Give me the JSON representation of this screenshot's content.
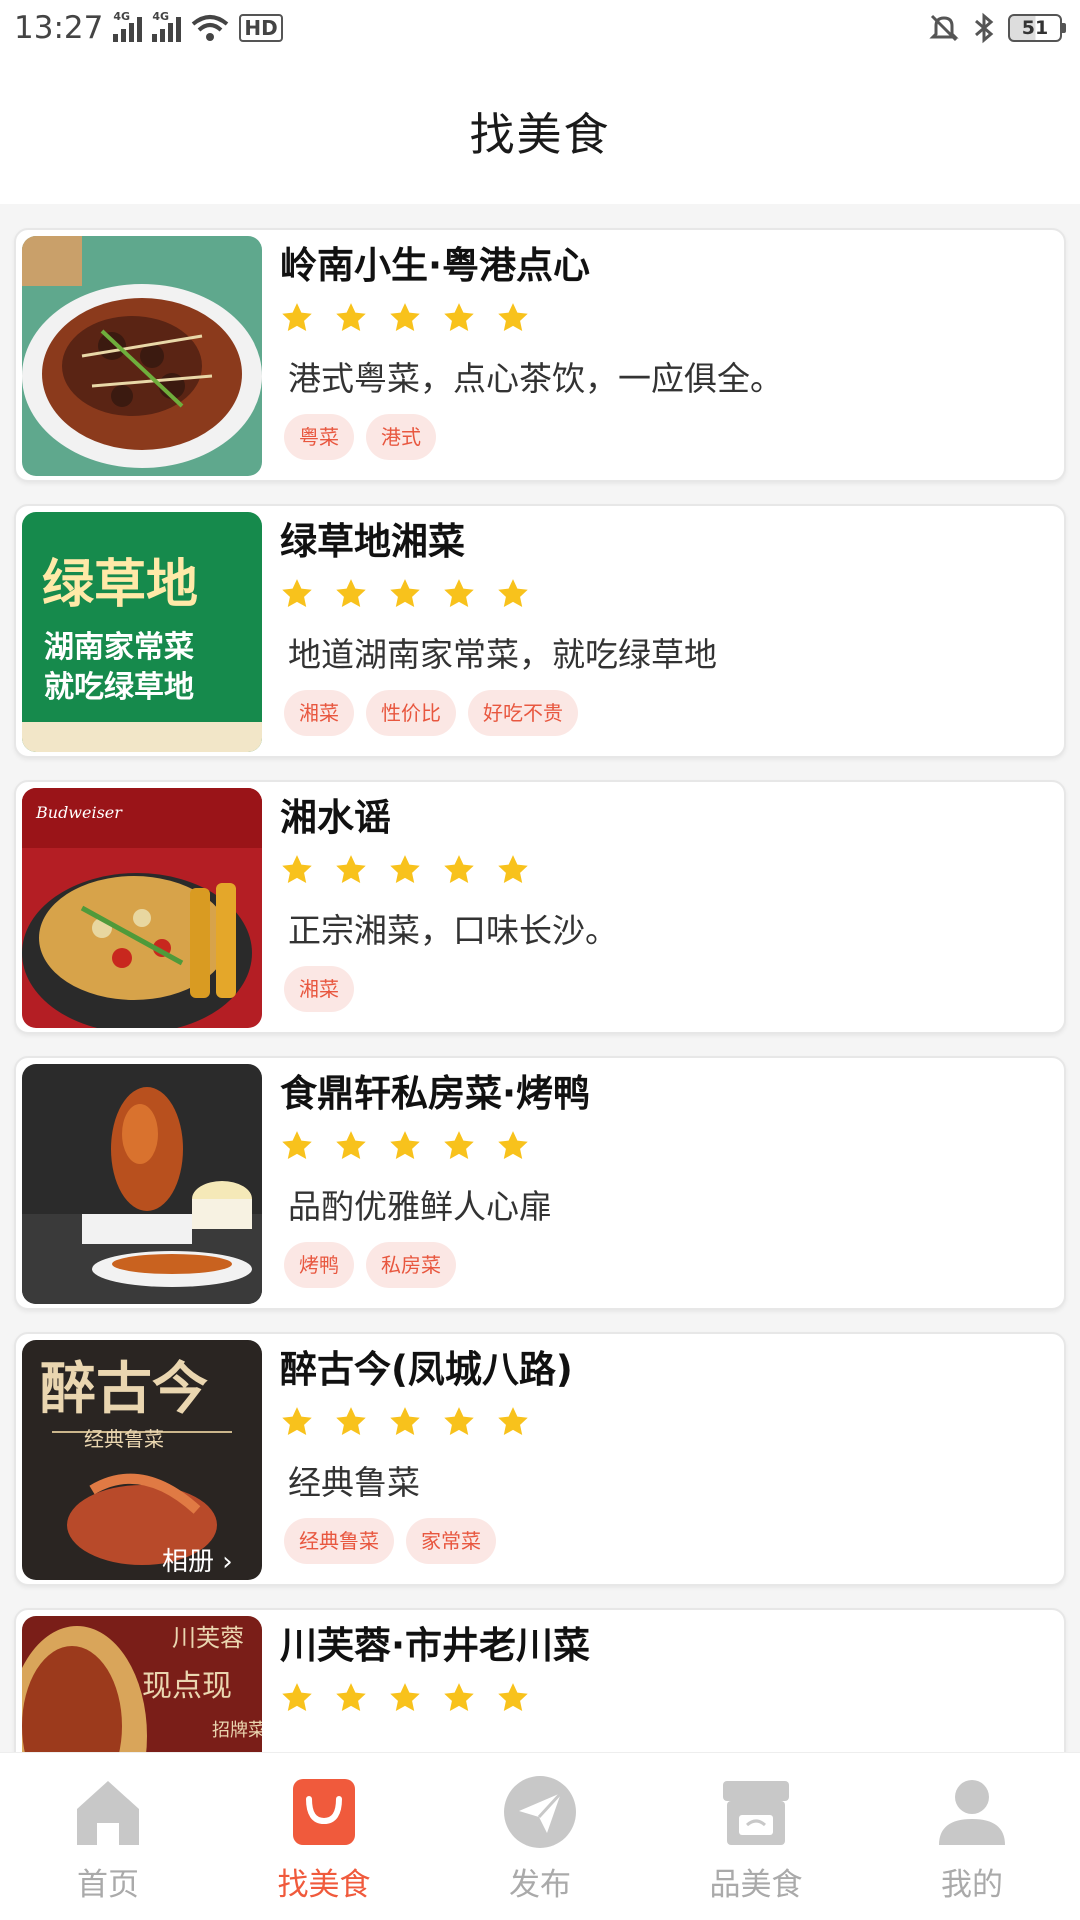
{
  "status_bar": {
    "time": "13:27",
    "network_1": "4G",
    "network_2": "4G",
    "hd_label": "HD",
    "battery": "51"
  },
  "page_title": "找美食",
  "restaurants": [
    {
      "name": "岭南小生·粤港点心",
      "rating": 5,
      "description": "港式粤菜，点心茶饮，一应俱全。",
      "tags": [
        "粤菜",
        "港式"
      ],
      "image_caption": ""
    },
    {
      "name": "绿草地湘菜",
      "rating": 5,
      "description": "地道湖南家常菜，就吃绿草地",
      "tags": [
        "湘菜",
        "性价比",
        "好吃不贵"
      ],
      "image_caption": "绿草地",
      "image_line_1": "湖南家常菜",
      "image_line_2": "就吃绿草地"
    },
    {
      "name": "湘水谣",
      "rating": 5,
      "description": "正宗湘菜，口味长沙。",
      "tags": [
        "湘菜"
      ],
      "image_caption": "Budweiser"
    },
    {
      "name": "食鼎轩私房菜·烤鸭",
      "rating": 5,
      "description": "品酌优雅鲜人心扉",
      "tags": [
        "烤鸭",
        "私房菜"
      ],
      "image_caption": ""
    },
    {
      "name": "醉古今(凤城八路)",
      "rating": 5,
      "description": "经典鲁菜",
      "tags": [
        "经典鲁菜",
        "家常菜"
      ],
      "image_caption": "醉古今",
      "image_line_1": "经典鲁菜",
      "image_line_2": "相册 ›"
    },
    {
      "name": "川芙蓉·市井老川菜",
      "rating": 5,
      "description": "",
      "tags": [],
      "image_caption": "川芙蓉",
      "image_line_1": "现点现",
      "image_line_2": "招牌菜"
    }
  ],
  "tabbar": {
    "items": [
      {
        "label": "首页",
        "icon": "home-icon",
        "active": false
      },
      {
        "label": "找美食",
        "icon": "shopping-bag-icon",
        "active": true
      },
      {
        "label": "发布",
        "icon": "send-icon",
        "active": false
      },
      {
        "label": "品美食",
        "icon": "store-icon",
        "active": false
      },
      {
        "label": "我的",
        "icon": "user-icon",
        "active": false
      }
    ]
  },
  "colors": {
    "accent": "#f05a3c",
    "star": "#f8c21c",
    "tag_text": "#e8573f",
    "tag_bg": "#fbe7e4",
    "inactive": "#aaaaaa"
  }
}
